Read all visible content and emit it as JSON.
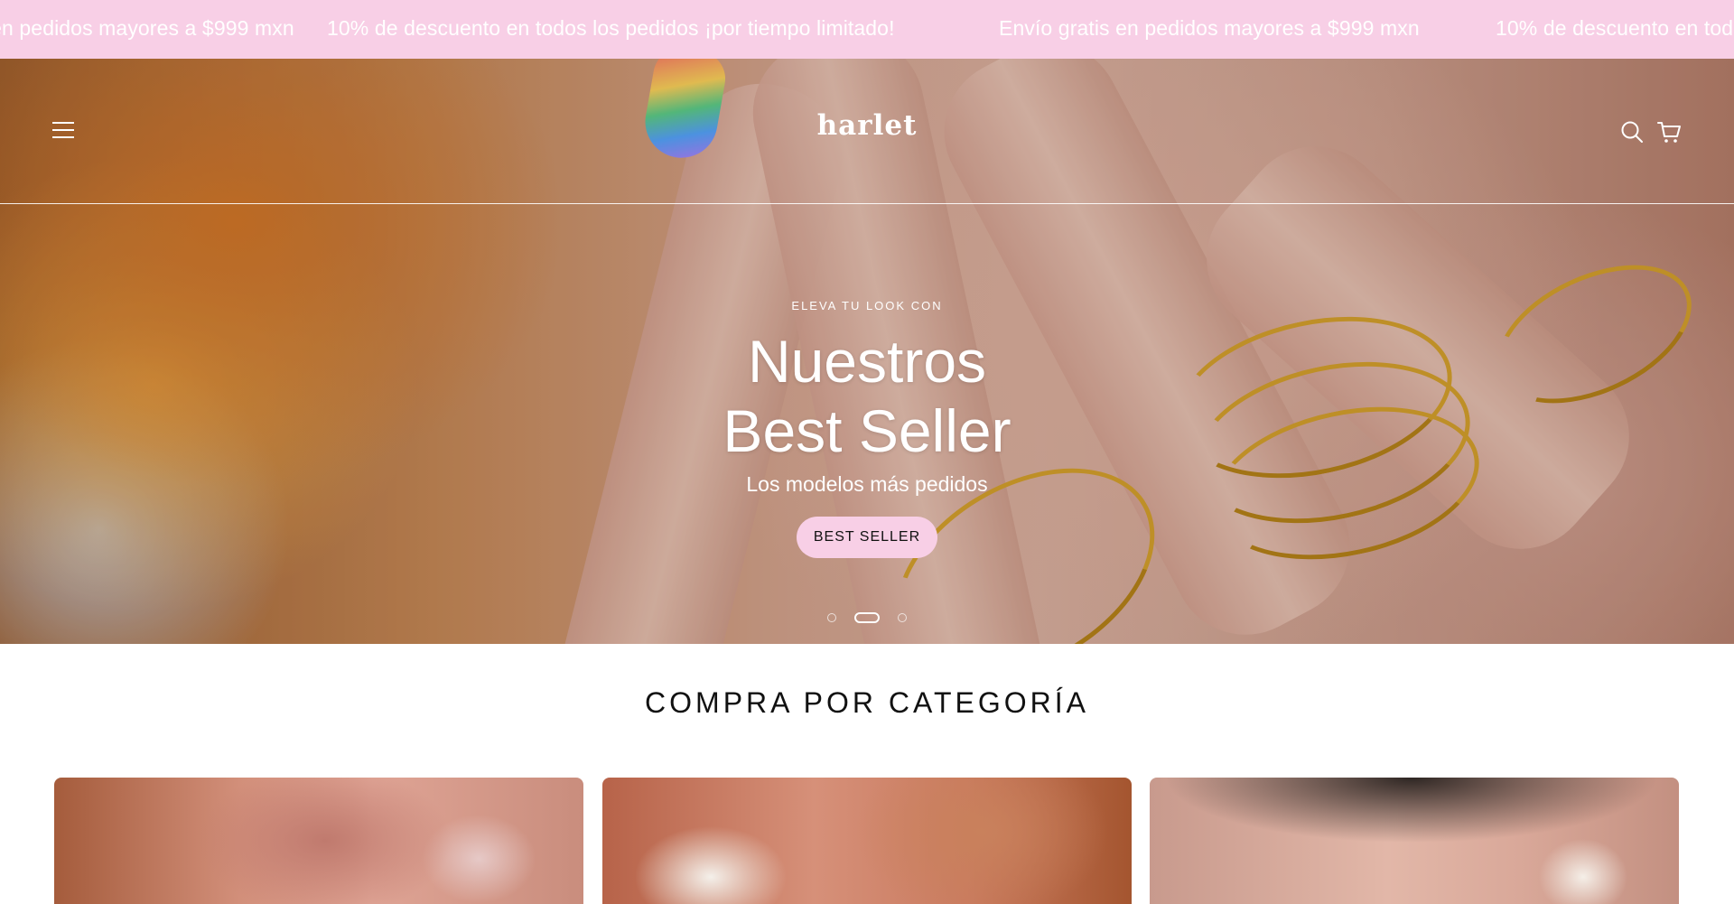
{
  "announcement": {
    "items": [
      "Envío gratis en pedidos mayores a $999 mxn",
      "10% de descuento en todos los pedidos ¡por tiempo limitado!",
      "Envío gratis en pedidos mayores a $999 mxn",
      "10% de descuento en todos los pedidos ¡por tiempo limitado!"
    ]
  },
  "header": {
    "logo": "harlet",
    "menu_icon": "hamburger-menu-icon",
    "search_icon": "search-icon",
    "cart_icon": "cart-icon"
  },
  "hero": {
    "eyebrow": "ELEVA TU LOOK CON",
    "headline_line1": "Nuestros",
    "headline_line2": "Best Seller",
    "subheadline": "Los modelos más pedidos",
    "cta_label": "BEST SELLER",
    "slides_total": 3,
    "active_slide": 2
  },
  "categories": {
    "title": "COMPRA POR CATEGORÍA",
    "cards": 3
  },
  "colors": {
    "accent_pink": "#f8cfe6",
    "text_dark": "#111111",
    "text_light": "#ffffff"
  }
}
